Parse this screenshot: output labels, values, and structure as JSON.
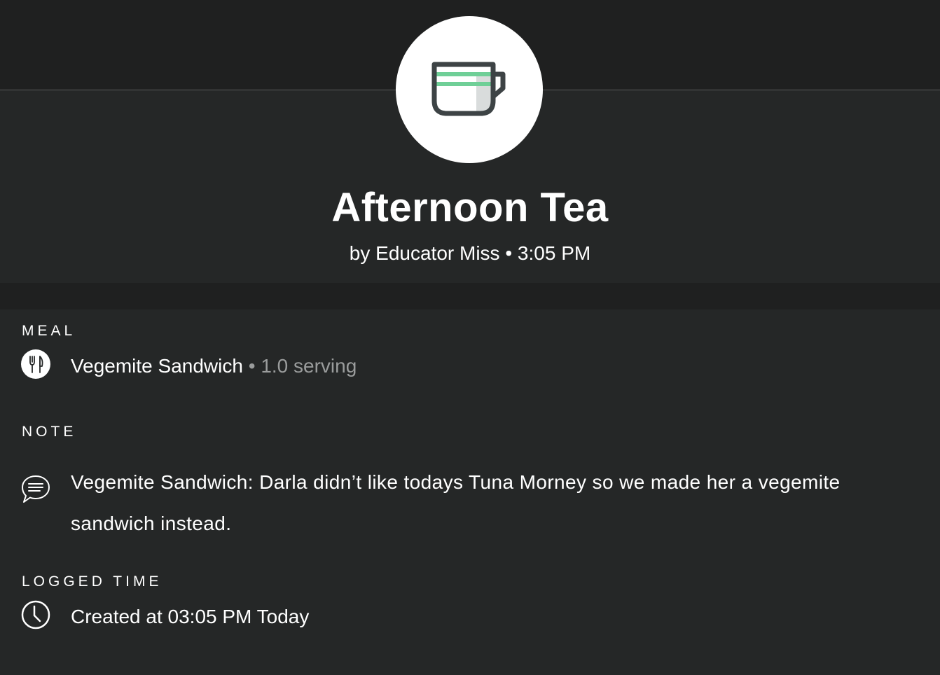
{
  "header": {
    "title": "Afternoon Tea",
    "author": "by Educator Miss",
    "separator": "•",
    "time": "3:05 PM"
  },
  "icons": {
    "activity": "tea-cup-icon",
    "meal": "cutlery-icon",
    "note": "chat-bubble-icon",
    "logged_time": "clock-icon"
  },
  "colors": {
    "page_background": "#252727",
    "band_background": "#1f2020",
    "avatar_background": "#ffffff",
    "cup_stripe": "#6fcf97",
    "cup_outline": "#3d4345",
    "muted_text": "#9a9c9c"
  },
  "meal": {
    "label": "MEAL",
    "item": "Vegemite Sandwich",
    "separator": "•",
    "serving": "1.0 serving"
  },
  "note": {
    "label": "NOTE",
    "text": "Vegemite Sandwich: Darla didn’t like todays Tuna Morney so we made her a vegemite sandwich instead."
  },
  "logged_time": {
    "label": "LOGGED TIME",
    "text": "Created at 03:05 PM Today"
  }
}
